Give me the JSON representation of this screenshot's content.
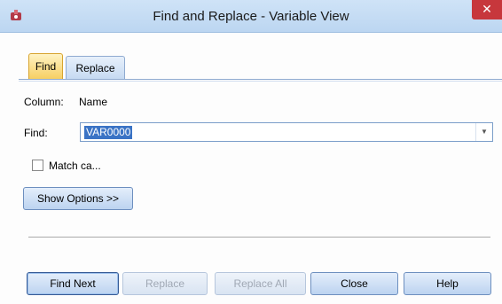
{
  "window": {
    "title": "Find and Replace - Variable View",
    "close_glyph": "✕"
  },
  "tabs": [
    {
      "label": "Find",
      "active": true
    },
    {
      "label": "Replace",
      "active": false
    }
  ],
  "column": {
    "label": "Column:",
    "value": "Name"
  },
  "find": {
    "label": "Find:",
    "value": "VAR0000",
    "dropdown_glyph": "▼"
  },
  "match_case": {
    "label": "Match ca...",
    "checked": false
  },
  "show_options_label": "Show Options >>",
  "buttons": {
    "find_next": "Find Next",
    "replace": "Replace",
    "replace_all": "Replace All",
    "close": "Close",
    "help": "Help"
  },
  "colors": {
    "title_bar": "#bcd6f1",
    "active_tab": "#f6cf63",
    "close_button": "#c7373c",
    "selection": "#3a73c5"
  },
  "icons": {
    "app": "spss-app-icon"
  }
}
